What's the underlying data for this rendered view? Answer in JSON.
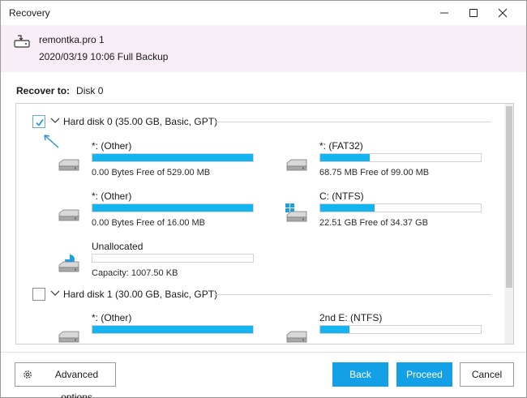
{
  "window": {
    "title": "Recovery"
  },
  "backup": {
    "name": "remontka.pro 1",
    "date": "2020/03/19 10:06 Full Backup"
  },
  "recover_to": {
    "label": "Recover to:",
    "value": "Disk 0"
  },
  "disks": [
    {
      "label": "Hard disk 0 (35.00 GB, Basic, GPT)",
      "checked": true,
      "partitions": [
        {
          "name": "*: (Other)",
          "info": "0.00 Bytes Free of 529.00 MB",
          "used_fraction": 1.0,
          "icon": "hdd-icon"
        },
        {
          "name": "*: (FAT32)",
          "info": "68.75 MB Free of 99.00 MB",
          "used_fraction": 0.31,
          "icon": "hdd-icon"
        },
        {
          "name": "*: (Other)",
          "info": "0.00 Bytes Free of 16.00 MB",
          "used_fraction": 1.0,
          "icon": "hdd-icon"
        },
        {
          "name": "C: (NTFS)",
          "info": "22.51 GB Free of 34.37 GB",
          "used_fraction": 0.34,
          "icon": "windows-hdd-icon"
        },
        {
          "name": "Unallocated",
          "info": "Capacity: 1007.50 KB",
          "used_fraction": 0.0,
          "icon": "unallocated-icon"
        }
      ]
    },
    {
      "label": "Hard disk 1 (30.00 GB, Basic, GPT)",
      "checked": false,
      "partitions": [
        {
          "name": "*: (Other)",
          "info": "",
          "used_fraction": 1.0,
          "icon": "hdd-icon"
        },
        {
          "name": "2nd E: (NTFS)",
          "info": "",
          "used_fraction": 0.18,
          "icon": "hdd-icon"
        }
      ]
    }
  ],
  "buttons": {
    "advanced": "Advanced options",
    "back": "Back",
    "proceed": "Proceed",
    "cancel": "Cancel"
  },
  "colors": {
    "accent": "#14a0e6",
    "bar_fill": "#14b4f0",
    "header_bg": "#f7eef7"
  }
}
